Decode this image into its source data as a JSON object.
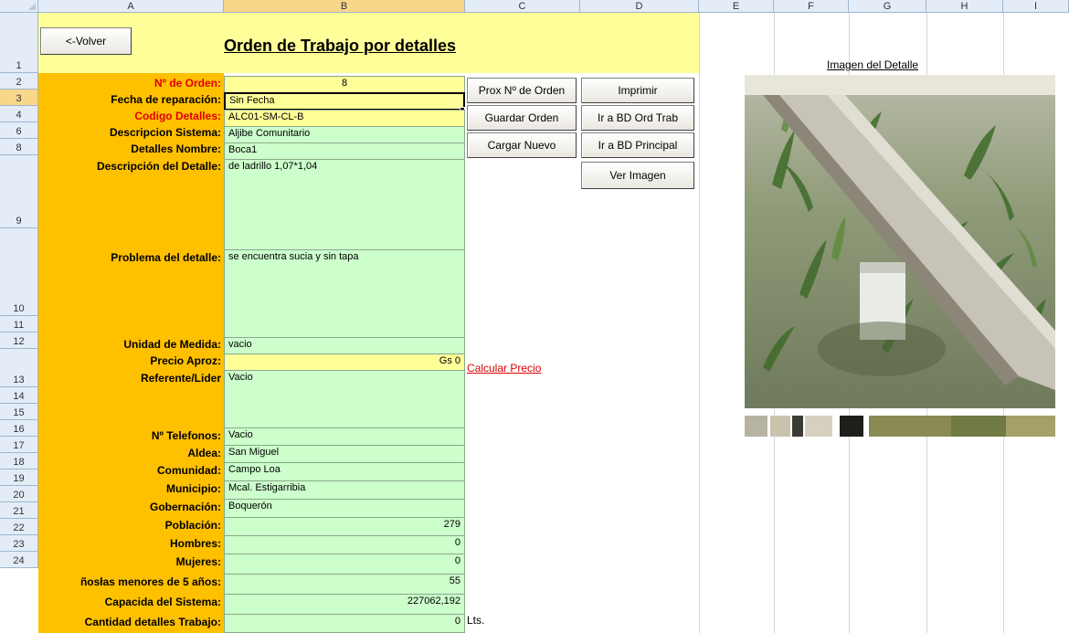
{
  "sheet": {
    "columns": [
      "A",
      "B",
      "C",
      "D",
      "E",
      "F",
      "G",
      "H",
      "I"
    ],
    "selected_column": "B",
    "rows": [
      {
        "id": "1",
        "h": 66
      },
      {
        "id": "2",
        "h": 18
      },
      {
        "id": "3",
        "h": 18
      },
      {
        "id": "4",
        "h": 18
      },
      {
        "id": "6",
        "h": 18
      },
      {
        "id": "8",
        "h": 18
      },
      {
        "id": "9",
        "h": 80
      },
      {
        "id": "10",
        "h": 96
      },
      {
        "id": "11",
        "h": 18
      },
      {
        "id": "12",
        "h": 18
      },
      {
        "id": "13",
        "h": 42
      },
      {
        "id": "14",
        "h": 18
      },
      {
        "id": "15",
        "h": 18
      },
      {
        "id": "16",
        "h": 18
      },
      {
        "id": "17",
        "h": 18
      },
      {
        "id": "18",
        "h": 18
      },
      {
        "id": "19",
        "h": 18
      },
      {
        "id": "20",
        "h": 18
      },
      {
        "id": "21",
        "h": 18
      },
      {
        "id": "22",
        "h": 18
      },
      {
        "id": "23",
        "h": 18
      },
      {
        "id": "24",
        "h": 18
      }
    ],
    "selected_row": "3"
  },
  "header": {
    "back_button": "<-Volver",
    "title": "Orden  de Trabajo por detalles"
  },
  "form": {
    "orden_label": "Nº de Orden:",
    "orden_value": "8",
    "fecha_label": "Fecha de reparación:",
    "fecha_value": "Sin Fecha",
    "codigo_label": "Codigo Detalles:",
    "codigo_value": "ALC01-SM-CL-B",
    "desc_sistema_label": "Descripcion Sistema:",
    "desc_sistema_value": "Aljibe Comunitario",
    "detalles_nombre_label": "Detalles Nombre:",
    "detalles_nombre_value": "Boca1",
    "desc_detalle_label": "Descripción del Detalle:",
    "desc_detalle_value": "de ladrillo 1,07*1,04",
    "problema_label": "Problema del detalle:",
    "problema_value": "se encuentra sucia y sin tapa",
    "unidad_label": "Unidad de Medida:",
    "unidad_value": "vacio",
    "precio_label": "Precio Aproz:",
    "precio_value": "Gs 0",
    "referente_label": "Referente/Lider",
    "referente_value": "Vacio",
    "telefonos_label": "Nº Telefonos:",
    "telefonos_value": "Vacio",
    "aldea_label": "Aldea:",
    "aldea_value": "San Miguel",
    "comunidad_label": "Comunidad:",
    "comunidad_value": "Campo Loa",
    "municipio_label": "Municipio:",
    "municipio_value": "Mcal. Estigarribia",
    "gobernacion_label": "Gobernación:",
    "gobernacion_value": "Boquerón",
    "poblacion_label": "Población:",
    "poblacion_value": "279",
    "hombres_label": "Hombres:",
    "hombres_value": "0",
    "mujeres_label": "Mujeres:",
    "mujeres_value": "0",
    "ninos_label": "ñosłas menores de 5 años:",
    "ninos_value": "55",
    "capacidad_label": "Capacida del Sistema:",
    "capacidad_value": "227062,192",
    "capacidad_unit": "Lts.",
    "cantidad_label": "Cantidad detalles Trabajo:",
    "cantidad_value": "0"
  },
  "buttons": {
    "prox_orden": "Prox Nº de Orden",
    "imprimir": "Imprimir",
    "guardar_orden": "Guardar Orden",
    "ir_bd_ord_trab": "Ir a BD Ord Trab",
    "cargar_nuevo": "Cargar Nuevo",
    "ir_bd_principal": "Ir a BD Principal",
    "ver_imagen": "Ver Imagen"
  },
  "links": {
    "calcular_precio": "Calcular Precio"
  },
  "image_panel": {
    "title": "Imagen del Detalle"
  },
  "colors": {
    "label_bg": "#ffc000",
    "value_bg": "#ccffcc",
    "title_bg": "#ffff99",
    "accent_red": "#e00000"
  }
}
